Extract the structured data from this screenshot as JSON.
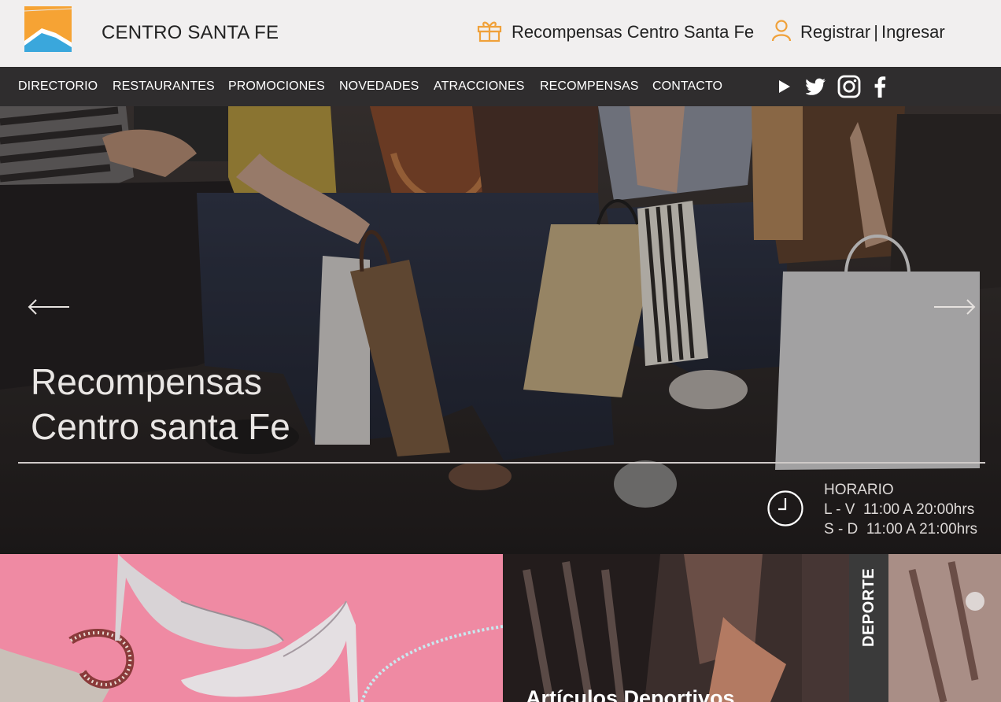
{
  "header": {
    "brand_name": "CENTRO SANTA FE",
    "rewards_link": "Recompensas Centro Santa Fe",
    "register_link": "Registrar",
    "separator": "|",
    "login_link": "Ingresar"
  },
  "nav": {
    "items": [
      {
        "label": "DIRECTORIO"
      },
      {
        "label": "RESTAURANTES"
      },
      {
        "label": "PROMOCIONES"
      },
      {
        "label": "NOVEDADES"
      },
      {
        "label": "ATRACCIONES"
      },
      {
        "label": "RECOMPENSAS"
      },
      {
        "label": "CONTACTO"
      }
    ],
    "social_icons": [
      "youtube-play-icon",
      "twitter-icon",
      "instagram-icon",
      "facebook-icon"
    ]
  },
  "hero": {
    "title_line1": "Recompensas",
    "title_line2": "Centro santa Fe",
    "schedule": {
      "heading": "HORARIO",
      "weekdays": "L - V  11:00 A 20:00hrs",
      "weekend": "S - D  11:00 A 21:00hrs"
    }
  },
  "tiles": {
    "sports_tag": "DEPORTE",
    "sports_title": "Artículos Deportivos"
  },
  "colors": {
    "topbar_bg": "#f1efef",
    "navbar_bg": "#2f2d2e",
    "accent_orange": "#f0a13a",
    "logo_blue": "#3aa7dc",
    "tile_pink": "#ef8aa3"
  }
}
